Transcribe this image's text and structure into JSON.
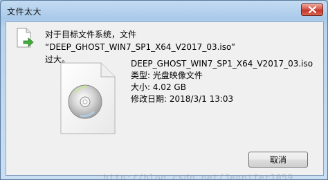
{
  "window": {
    "title": "文件太大"
  },
  "message": {
    "line1": "对于目标文件系统，文件 “DEEP_GHOST_WIN7_SP1_X64_V2017_03.iso”",
    "line2": "过大。"
  },
  "file": {
    "name": "DEEP_GHOST_WIN7_SP1_X64_V2017_03.iso",
    "type": "类型: 光盘映像文件",
    "size": "大小: 4.02 GB",
    "modified": "修改日期: 2018/3/1 13:03"
  },
  "buttons": {
    "cancel": "取消"
  },
  "watermark": "http://blog.csdn.net/Jennifer1059",
  "icons": {
    "close": "close-icon",
    "info": "document-arrow-icon",
    "file": "disc-file-icon"
  },
  "colors": {
    "close_button": "#d7574a",
    "titlebar": "#b8d3ee",
    "content_bg": "#f0f0f0"
  }
}
